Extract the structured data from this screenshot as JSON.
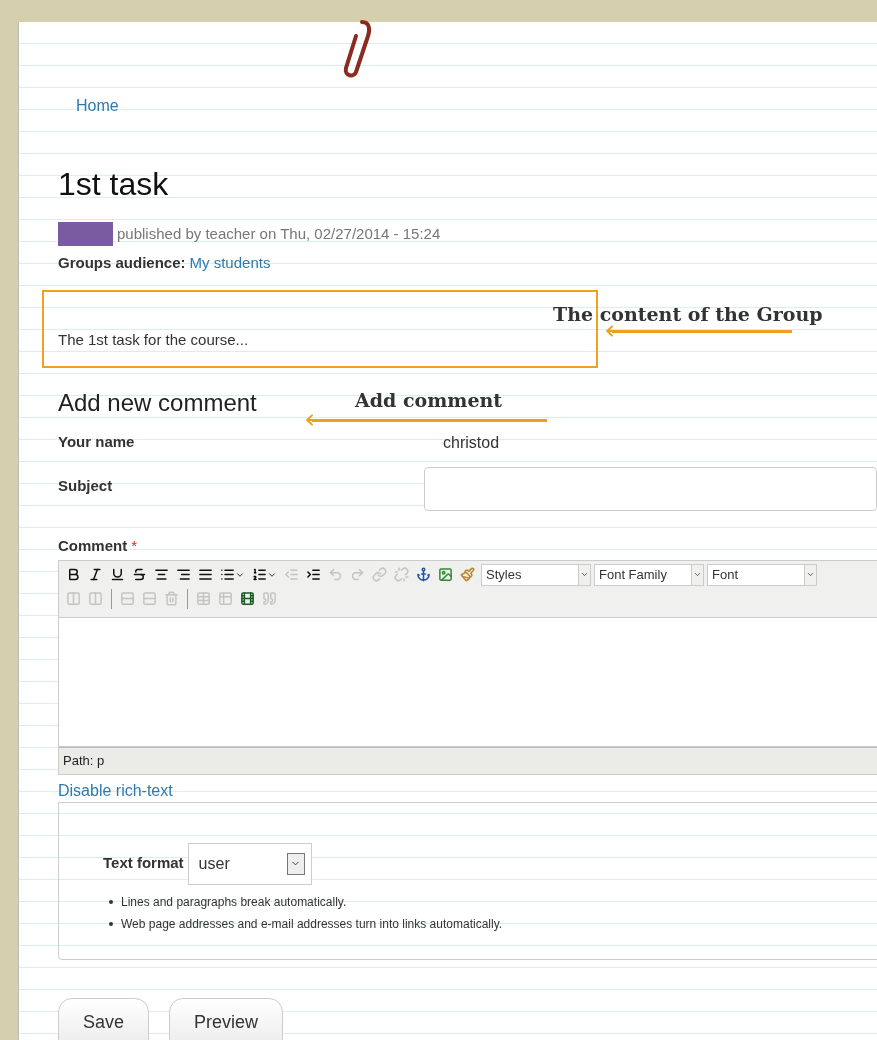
{
  "breadcrumb": "Home",
  "title": "1st task",
  "meta": {
    "text": "published by teacher on Thu, 02/27/2014 - 15:24"
  },
  "groups_audience": {
    "label": "Groups audience:",
    "value": "My students"
  },
  "body": "The 1st task for the course...",
  "annotations": [
    {
      "kind": "box",
      "text": "The content of the Group"
    },
    {
      "kind": "arrow",
      "text": "Add comment"
    }
  ],
  "comment_form": {
    "heading": "Add new comment",
    "name_label": "Your name",
    "name_value": "christod",
    "subject_label": "Subject",
    "comment_label": "Comment",
    "required_mark": "*",
    "toolbar_row_1": [
      {
        "kind": "bold",
        "disabled": false
      },
      {
        "kind": "italic",
        "disabled": false
      },
      {
        "kind": "underline",
        "disabled": false
      },
      {
        "kind": "strike",
        "disabled": false
      },
      {
        "kind": "center",
        "disabled": false
      },
      {
        "kind": "right",
        "disabled": false
      },
      {
        "kind": "justify",
        "disabled": false
      },
      {
        "kind": "bullets",
        "disabled": false
      },
      {
        "kind": "numbers",
        "disabled": false
      },
      {
        "kind": "outdent",
        "disabled": true
      },
      {
        "kind": "indent",
        "disabled": false
      },
      {
        "kind": "undo",
        "disabled": true
      },
      {
        "kind": "redo",
        "disabled": true
      },
      {
        "kind": "link",
        "disabled": true
      },
      {
        "kind": "unlink",
        "disabled": true
      },
      {
        "kind": "anchor",
        "disabled": false
      },
      {
        "kind": "image",
        "disabled": false
      },
      {
        "kind": "cleanup",
        "disabled": false
      }
    ],
    "dropdowns": [
      "Styles",
      "Font Family",
      "Font"
    ],
    "toolbar_row_2": [
      {
        "kind": "col-before",
        "disabled": true
      },
      {
        "kind": "col-after",
        "disabled": true
      },
      {
        "kind": "separator"
      },
      {
        "kind": "row-before",
        "disabled": true
      },
      {
        "kind": "row-after",
        "disabled": true
      },
      {
        "kind": "delete-row",
        "disabled": true
      },
      {
        "kind": "separator"
      },
      {
        "kind": "table",
        "disabled": true
      },
      {
        "kind": "table-props",
        "disabled": true
      },
      {
        "kind": "media",
        "disabled": false
      },
      {
        "kind": "quote",
        "disabled": true
      }
    ],
    "path": "Path: p",
    "toggle_link": "Disable rich-text",
    "format_label": "Text format",
    "format_value": "user",
    "tips": [
      "Lines and paragraphs break automatically.",
      "Web page addresses and e-mail addresses turn into links automatically."
    ],
    "buttons": [
      "Save",
      "Preview"
    ]
  }
}
